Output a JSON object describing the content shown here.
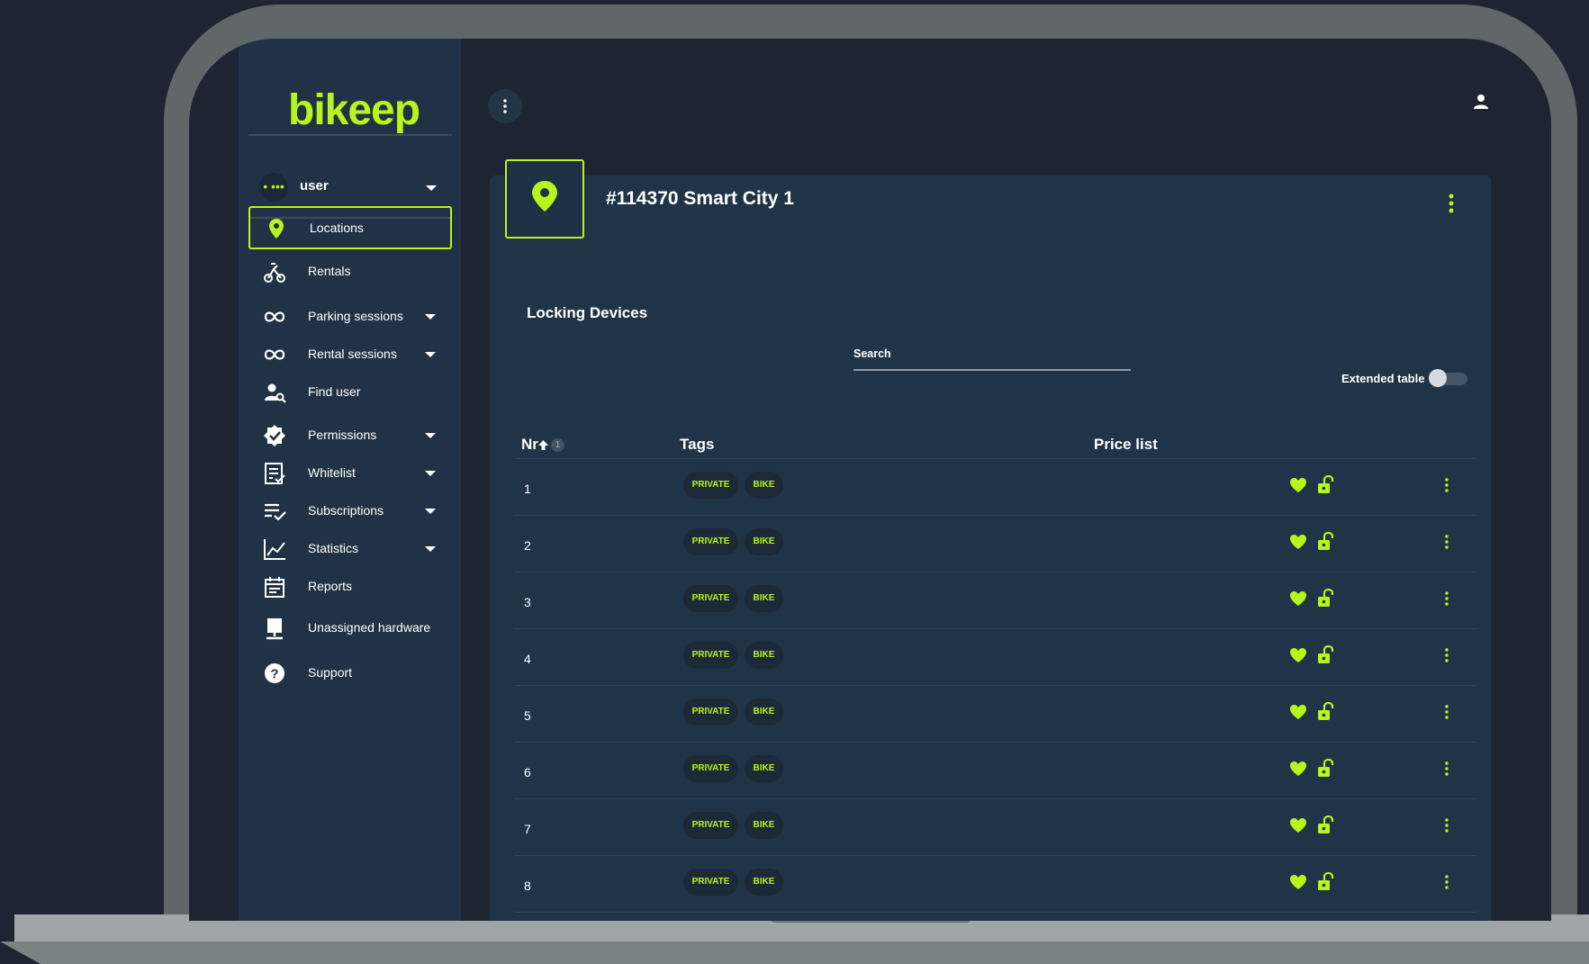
{
  "brand": {
    "logo_text": "bikeep",
    "accent_color": "#b6f51e"
  },
  "user_menu": {
    "name": "user",
    "avatar_glyph": "• •••"
  },
  "sidebar": {
    "items": [
      {
        "label": "Locations",
        "icon": "location-pin-icon",
        "active": true,
        "has_caret": false
      },
      {
        "label": "Rentals",
        "icon": "rentals-icon",
        "active": false,
        "has_caret": false
      },
      {
        "label": "Parking sessions",
        "icon": "infinity-icon",
        "active": false,
        "has_caret": true
      },
      {
        "label": "Rental sessions",
        "icon": "infinity-icon",
        "active": false,
        "has_caret": true
      },
      {
        "label": "Find user",
        "icon": "find-user-icon",
        "active": false,
        "has_caret": false
      },
      {
        "label": "Permissions",
        "icon": "verified-badge-icon",
        "active": false,
        "has_caret": true
      },
      {
        "label": "Whitelist",
        "icon": "checklist-icon",
        "active": false,
        "has_caret": true
      },
      {
        "label": "Subscriptions",
        "icon": "playlist-check-icon",
        "active": false,
        "has_caret": true
      },
      {
        "label": "Statistics",
        "icon": "line-chart-icon",
        "active": false,
        "has_caret": true
      },
      {
        "label": "Reports",
        "icon": "calendar-icon",
        "active": false,
        "has_caret": false
      },
      {
        "label": "Unassigned hardware",
        "icon": "hardware-icon",
        "active": false,
        "has_caret": false
      },
      {
        "label": "Support",
        "icon": "help-circle-icon",
        "active": false,
        "has_caret": false
      }
    ]
  },
  "location": {
    "title": "#114370 Smart City 1"
  },
  "devices": {
    "section_title": "Locking Devices",
    "search_label": "Search",
    "extended_table_label": "Extended table",
    "extended_table_on": false,
    "columns": {
      "nr": "Nr",
      "tags": "Tags",
      "price_list": "Price list"
    },
    "sort_badge": "1",
    "rows": [
      {
        "nr": "1",
        "tags": [
          "PRIVATE",
          "BIKE"
        ]
      },
      {
        "nr": "2",
        "tags": [
          "PRIVATE",
          "BIKE"
        ]
      },
      {
        "nr": "3",
        "tags": [
          "PRIVATE",
          "BIKE"
        ]
      },
      {
        "nr": "4",
        "tags": [
          "PRIVATE",
          "BIKE"
        ]
      },
      {
        "nr": "5",
        "tags": [
          "PRIVATE",
          "BIKE"
        ]
      },
      {
        "nr": "6",
        "tags": [
          "PRIVATE",
          "BIKE"
        ]
      },
      {
        "nr": "7",
        "tags": [
          "PRIVATE",
          "BIKE"
        ]
      },
      {
        "nr": "8",
        "tags": [
          "PRIVATE",
          "BIKE"
        ]
      }
    ]
  }
}
